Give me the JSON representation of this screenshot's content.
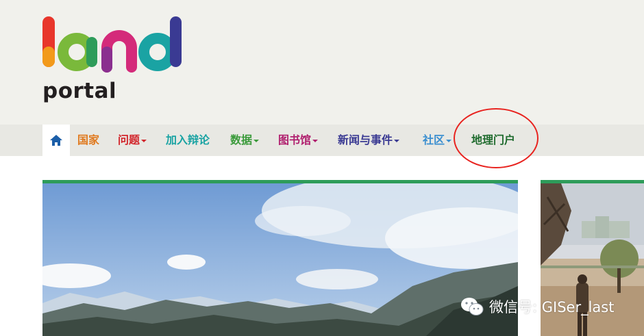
{
  "colors": {
    "header_bg": "#f1f1ec",
    "nav_bg": "#e8e8e3",
    "accent_green": "#2e9c5a",
    "highlight_circle": "#e8231f"
  },
  "logo": {
    "word_top": "land",
    "word_bottom": "portal"
  },
  "nav": {
    "home_icon": "home-icon",
    "items": [
      {
        "label": "国家",
        "color": "#e07a1f",
        "dropdown": false
      },
      {
        "label": "问题",
        "color": "#d2262c",
        "dropdown": true
      },
      {
        "label": "加入辩论",
        "color": "#1aa3a3",
        "dropdown": false
      },
      {
        "label": "数据",
        "color": "#3a9a3a",
        "dropdown": true
      },
      {
        "label": "图书馆",
        "color": "#b01f6e",
        "dropdown": true
      },
      {
        "label": "新闻与事件",
        "color": "#3a3a93",
        "dropdown": true
      },
      {
        "label": "社区",
        "color": "#3b8fd0",
        "dropdown": true
      },
      {
        "label": "地理门户",
        "color": "#1f6b2e",
        "dropdown": false
      }
    ]
  },
  "watermark": {
    "icon": "wechat-icon",
    "text": "微信号: GISer_last"
  }
}
